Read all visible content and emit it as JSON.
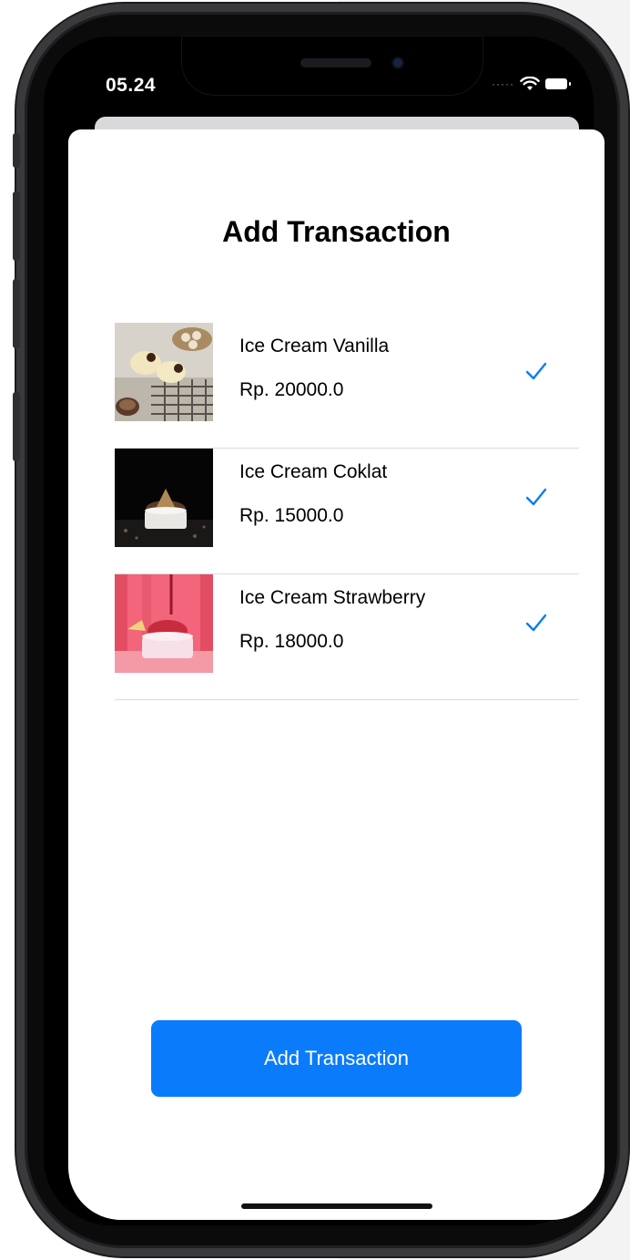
{
  "status_bar": {
    "time": "05.24",
    "signal_icon": "cellular-dots-icon",
    "wifi_icon": "wifi-icon",
    "battery_icon": "battery-icon"
  },
  "screen": {
    "title": "Add Transaction",
    "items": [
      {
        "name": "Ice Cream Vanilla",
        "price": "Rp. 20000.0",
        "selected": true,
        "image": "vanilla-ice-cream-image"
      },
      {
        "name": "Ice Cream Coklat",
        "price": "Rp. 15000.0",
        "selected": true,
        "image": "chocolate-ice-cream-image"
      },
      {
        "name": "Ice Cream Strawberry",
        "price": "Rp. 18000.0",
        "selected": true,
        "image": "strawberry-ice-cream-image"
      }
    ],
    "add_button_label": "Add Transaction"
  },
  "colors": {
    "accent": "#0a7bfb",
    "check": "#0a7bfb",
    "separator": "#dcdcde"
  }
}
